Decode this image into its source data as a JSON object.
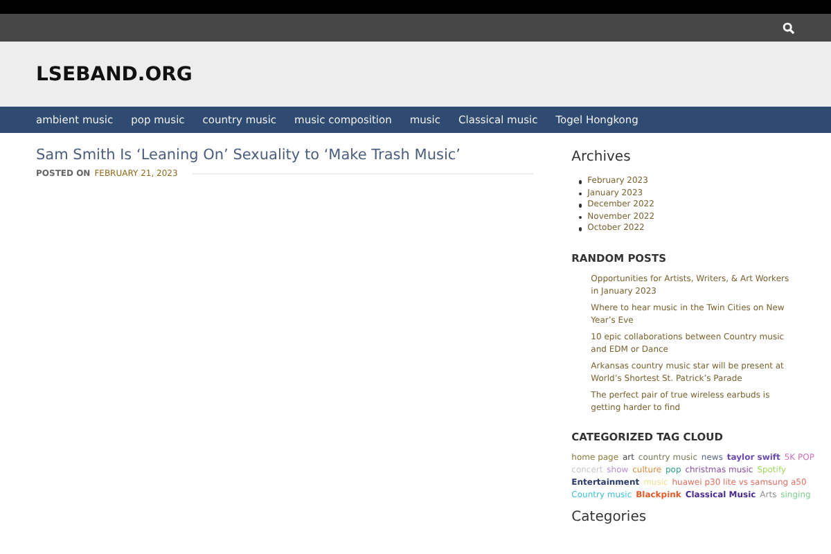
{
  "site": {
    "title": "LSEBAND.ORG"
  },
  "nav": [
    {
      "label": "ambient music"
    },
    {
      "label": "pop music"
    },
    {
      "label": "country music"
    },
    {
      "label": "music composition"
    },
    {
      "label": "music"
    },
    {
      "label": "Classical music"
    },
    {
      "label": "Togel Hongkong"
    }
  ],
  "post": {
    "title": "Sam Smith Is ‘Leaning On’ Sexuality to ‘Make Trash Music’",
    "posted_on": "POSTED ON",
    "date": "FEBRUARY 21, 2023"
  },
  "archives": {
    "title": "Archives",
    "items": [
      "February 2023",
      "January 2023",
      "December 2022",
      "November 2022",
      "October 2022"
    ]
  },
  "random_posts": {
    "title": "RANDOM POSTS",
    "items": [
      "Opportunities for Artists, Writers, & Art Workers in January 2023",
      "Where to hear music in the Twin Cities on New Year’s Eve",
      "10 epic collaborations between Country music and EDM or Dance",
      "Arkansas country music star will be present at World’s Shortest St. Patrick’s Parade",
      "The perfect pair of true wireless earbuds is getting harder to find"
    ]
  },
  "tag_cloud": {
    "title": "CATEGORIZED TAG CLOUD",
    "tags": [
      {
        "label": "home page",
        "color": "#8a7a3a",
        "bold": false
      },
      {
        "label": "art",
        "color": "#444444",
        "bold": false
      },
      {
        "label": "country music",
        "color": "#7a7a5a",
        "bold": false
      },
      {
        "label": "news",
        "color": "#5a6a8a",
        "bold": false
      },
      {
        "label": "taylor swift",
        "color": "#6a4ab0",
        "bold": true
      },
      {
        "label": "5K POP",
        "color": "#d070c0",
        "bold": false
      },
      {
        "label": "concert",
        "color": "#c8c8c8",
        "bold": false
      },
      {
        "label": "show",
        "color": "#b890d8",
        "bold": false
      },
      {
        "label": "culture",
        "color": "#e08a40",
        "bold": false
      },
      {
        "label": "pop",
        "color": "#30a090",
        "bold": false
      },
      {
        "label": "christmas music",
        "color": "#8a50a0",
        "bold": false
      },
      {
        "label": "Spotify",
        "color": "#a0d860",
        "bold": false
      },
      {
        "label": "Entertainment",
        "color": "#2a3a6a",
        "bold": true
      },
      {
        "label": "music",
        "color": "#f0e090",
        "bold": false
      },
      {
        "label": "huawei p30 lite vs samsung a50",
        "color": "#e07060",
        "bold": false
      },
      {
        "label": "Country music",
        "color": "#40c0d8",
        "bold": false
      },
      {
        "label": "Blackpink",
        "color": "#e05a2a",
        "bold": true
      },
      {
        "label": "Classical Music",
        "color": "#4a2a90",
        "bold": true
      },
      {
        "label": "Arts",
        "color": "#909090",
        "bold": false
      },
      {
        "label": "singing",
        "color": "#80d090",
        "bold": false
      }
    ]
  },
  "categories": {
    "title": "Categories"
  }
}
